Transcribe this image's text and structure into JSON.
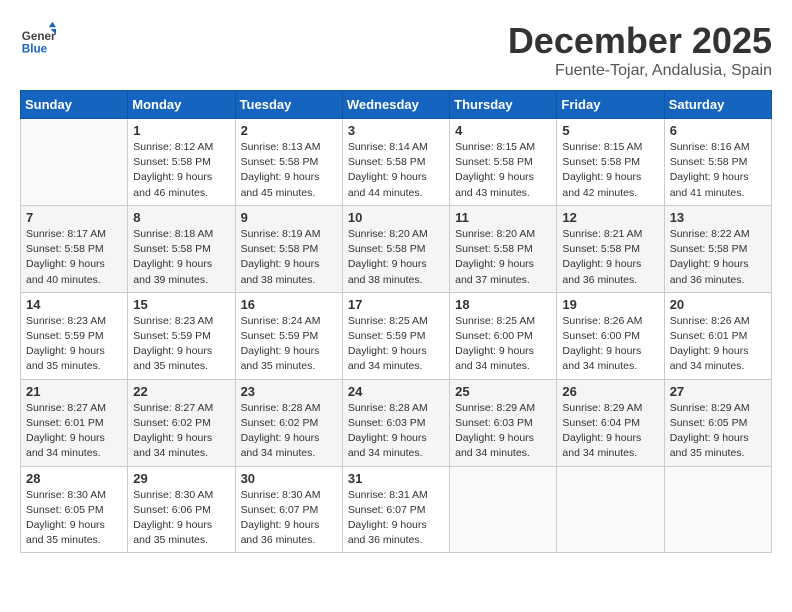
{
  "header": {
    "logo_general": "General",
    "logo_blue": "Blue",
    "month_title": "December 2025",
    "location": "Fuente-Tojar, Andalusia, Spain"
  },
  "weekdays": [
    "Sunday",
    "Monday",
    "Tuesday",
    "Wednesday",
    "Thursday",
    "Friday",
    "Saturday"
  ],
  "weeks": [
    [
      {
        "day": "",
        "empty": true
      },
      {
        "day": "1",
        "sunrise": "Sunrise: 8:12 AM",
        "sunset": "Sunset: 5:58 PM",
        "daylight": "Daylight: 9 hours and 46 minutes."
      },
      {
        "day": "2",
        "sunrise": "Sunrise: 8:13 AM",
        "sunset": "Sunset: 5:58 PM",
        "daylight": "Daylight: 9 hours and 45 minutes."
      },
      {
        "day": "3",
        "sunrise": "Sunrise: 8:14 AM",
        "sunset": "Sunset: 5:58 PM",
        "daylight": "Daylight: 9 hours and 44 minutes."
      },
      {
        "day": "4",
        "sunrise": "Sunrise: 8:15 AM",
        "sunset": "Sunset: 5:58 PM",
        "daylight": "Daylight: 9 hours and 43 minutes."
      },
      {
        "day": "5",
        "sunrise": "Sunrise: 8:15 AM",
        "sunset": "Sunset: 5:58 PM",
        "daylight": "Daylight: 9 hours and 42 minutes."
      },
      {
        "day": "6",
        "sunrise": "Sunrise: 8:16 AM",
        "sunset": "Sunset: 5:58 PM",
        "daylight": "Daylight: 9 hours and 41 minutes."
      }
    ],
    [
      {
        "day": "7",
        "sunrise": "Sunrise: 8:17 AM",
        "sunset": "Sunset: 5:58 PM",
        "daylight": "Daylight: 9 hours and 40 minutes."
      },
      {
        "day": "8",
        "sunrise": "Sunrise: 8:18 AM",
        "sunset": "Sunset: 5:58 PM",
        "daylight": "Daylight: 9 hours and 39 minutes."
      },
      {
        "day": "9",
        "sunrise": "Sunrise: 8:19 AM",
        "sunset": "Sunset: 5:58 PM",
        "daylight": "Daylight: 9 hours and 38 minutes."
      },
      {
        "day": "10",
        "sunrise": "Sunrise: 8:20 AM",
        "sunset": "Sunset: 5:58 PM",
        "daylight": "Daylight: 9 hours and 38 minutes."
      },
      {
        "day": "11",
        "sunrise": "Sunrise: 8:20 AM",
        "sunset": "Sunset: 5:58 PM",
        "daylight": "Daylight: 9 hours and 37 minutes."
      },
      {
        "day": "12",
        "sunrise": "Sunrise: 8:21 AM",
        "sunset": "Sunset: 5:58 PM",
        "daylight": "Daylight: 9 hours and 36 minutes."
      },
      {
        "day": "13",
        "sunrise": "Sunrise: 8:22 AM",
        "sunset": "Sunset: 5:58 PM",
        "daylight": "Daylight: 9 hours and 36 minutes."
      }
    ],
    [
      {
        "day": "14",
        "sunrise": "Sunrise: 8:23 AM",
        "sunset": "Sunset: 5:59 PM",
        "daylight": "Daylight: 9 hours and 35 minutes."
      },
      {
        "day": "15",
        "sunrise": "Sunrise: 8:23 AM",
        "sunset": "Sunset: 5:59 PM",
        "daylight": "Daylight: 9 hours and 35 minutes."
      },
      {
        "day": "16",
        "sunrise": "Sunrise: 8:24 AM",
        "sunset": "Sunset: 5:59 PM",
        "daylight": "Daylight: 9 hours and 35 minutes."
      },
      {
        "day": "17",
        "sunrise": "Sunrise: 8:25 AM",
        "sunset": "Sunset: 5:59 PM",
        "daylight": "Daylight: 9 hours and 34 minutes."
      },
      {
        "day": "18",
        "sunrise": "Sunrise: 8:25 AM",
        "sunset": "Sunset: 6:00 PM",
        "daylight": "Daylight: 9 hours and 34 minutes."
      },
      {
        "day": "19",
        "sunrise": "Sunrise: 8:26 AM",
        "sunset": "Sunset: 6:00 PM",
        "daylight": "Daylight: 9 hours and 34 minutes."
      },
      {
        "day": "20",
        "sunrise": "Sunrise: 8:26 AM",
        "sunset": "Sunset: 6:01 PM",
        "daylight": "Daylight: 9 hours and 34 minutes."
      }
    ],
    [
      {
        "day": "21",
        "sunrise": "Sunrise: 8:27 AM",
        "sunset": "Sunset: 6:01 PM",
        "daylight": "Daylight: 9 hours and 34 minutes."
      },
      {
        "day": "22",
        "sunrise": "Sunrise: 8:27 AM",
        "sunset": "Sunset: 6:02 PM",
        "daylight": "Daylight: 9 hours and 34 minutes."
      },
      {
        "day": "23",
        "sunrise": "Sunrise: 8:28 AM",
        "sunset": "Sunset: 6:02 PM",
        "daylight": "Daylight: 9 hours and 34 minutes."
      },
      {
        "day": "24",
        "sunrise": "Sunrise: 8:28 AM",
        "sunset": "Sunset: 6:03 PM",
        "daylight": "Daylight: 9 hours and 34 minutes."
      },
      {
        "day": "25",
        "sunrise": "Sunrise: 8:29 AM",
        "sunset": "Sunset: 6:03 PM",
        "daylight": "Daylight: 9 hours and 34 minutes."
      },
      {
        "day": "26",
        "sunrise": "Sunrise: 8:29 AM",
        "sunset": "Sunset: 6:04 PM",
        "daylight": "Daylight: 9 hours and 34 minutes."
      },
      {
        "day": "27",
        "sunrise": "Sunrise: 8:29 AM",
        "sunset": "Sunset: 6:05 PM",
        "daylight": "Daylight: 9 hours and 35 minutes."
      }
    ],
    [
      {
        "day": "28",
        "sunrise": "Sunrise: 8:30 AM",
        "sunset": "Sunset: 6:05 PM",
        "daylight": "Daylight: 9 hours and 35 minutes."
      },
      {
        "day": "29",
        "sunrise": "Sunrise: 8:30 AM",
        "sunset": "Sunset: 6:06 PM",
        "daylight": "Daylight: 9 hours and 35 minutes."
      },
      {
        "day": "30",
        "sunrise": "Sunrise: 8:30 AM",
        "sunset": "Sunset: 6:07 PM",
        "daylight": "Daylight: 9 hours and 36 minutes."
      },
      {
        "day": "31",
        "sunrise": "Sunrise: 8:31 AM",
        "sunset": "Sunset: 6:07 PM",
        "daylight": "Daylight: 9 hours and 36 minutes."
      },
      {
        "day": "",
        "empty": true
      },
      {
        "day": "",
        "empty": true
      },
      {
        "day": "",
        "empty": true
      }
    ]
  ]
}
